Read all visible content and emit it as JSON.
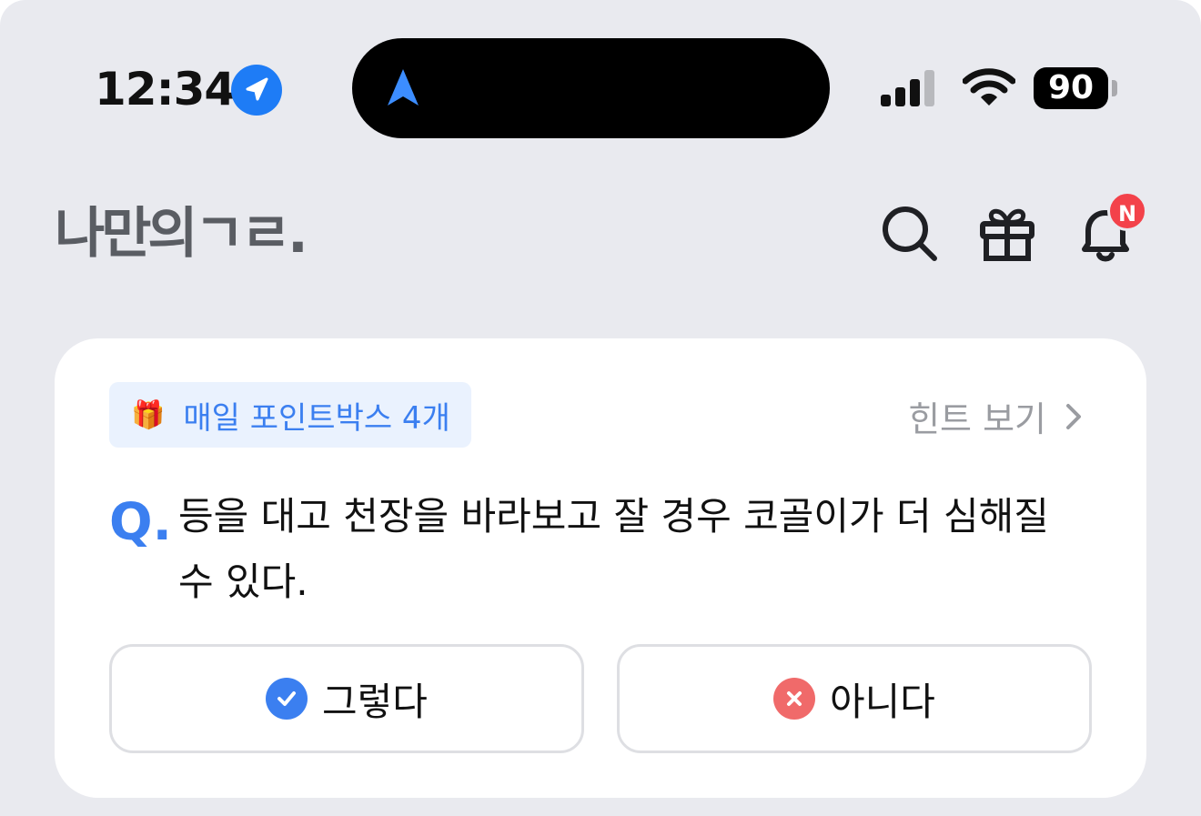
{
  "status_bar": {
    "time": "12:34",
    "battery": "90",
    "icons": [
      "location-arrow-icon",
      "navigation-icon",
      "cellular-signal-icon",
      "wifi-icon",
      "battery-icon"
    ]
  },
  "header": {
    "logo": "나만의ㄱㄹ.",
    "icons": [
      "search-icon",
      "gift-icon",
      "bell-icon"
    ],
    "notification_badge": "N"
  },
  "quiz_card": {
    "point_box_label": "매일 포인트박스 4개",
    "point_box_icon": "gift-emoji-icon",
    "hint_label": "힌트 보기",
    "question_prefix": "Q.",
    "question": "등을 대고 천장을 바라보고 잘 경우 코골이가 더 심해질 수 있다.",
    "answers": [
      {
        "label": "그렇다",
        "icon": "check-circle-icon",
        "color": "#3b7ff0"
      },
      {
        "label": "아니다",
        "icon": "x-circle-icon",
        "color": "#f06a6a"
      }
    ]
  },
  "colors": {
    "background": "#e9eaef",
    "accent": "#3b7ff0",
    "badge": "#f3424a"
  }
}
